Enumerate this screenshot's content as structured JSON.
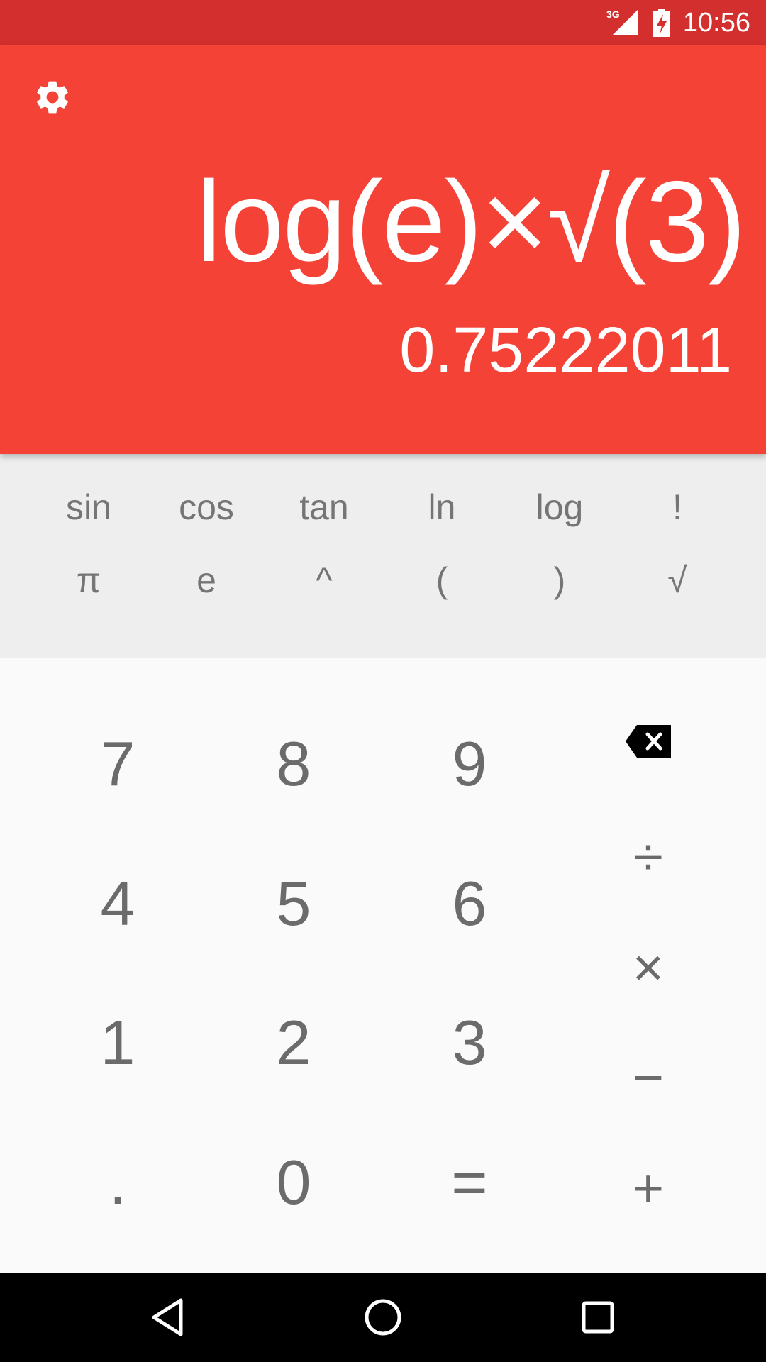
{
  "status_bar": {
    "network": "3G",
    "time": "10:56",
    "icons": [
      "signal-3g-icon",
      "battery-charging-icon"
    ]
  },
  "toolbar": {
    "settings_icon": "gear-icon"
  },
  "display": {
    "expression": "log(e)×√(3)",
    "result": "0.75222011"
  },
  "functions": {
    "row1": [
      "sin",
      "cos",
      "tan",
      "ln",
      "log",
      "!"
    ],
    "row2": [
      "π",
      "e",
      "^",
      "(",
      ")",
      "√"
    ]
  },
  "keypad": {
    "digits": [
      "7",
      "8",
      "9",
      "4",
      "5",
      "6",
      "1",
      "2",
      "3",
      ".",
      "0",
      "="
    ],
    "operators": [
      "÷",
      "×",
      "−",
      "+"
    ],
    "delete_icon": "backspace-icon"
  },
  "navigation": [
    "back-icon",
    "home-icon",
    "recents-icon"
  ],
  "colors": {
    "status_bar": "#d32f2f",
    "display": "#f44336",
    "function_panel": "#eeeeee",
    "keypad": "#fafafa",
    "key_text": "#6b6b6b"
  }
}
